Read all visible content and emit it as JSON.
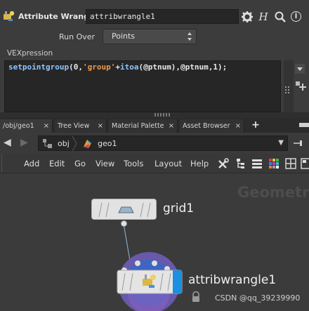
{
  "param_pane": {
    "node_type": "Attribute Wrangle",
    "node_name": "attribwrangle1",
    "run_over_label": "Run Over",
    "run_over_value": "Points",
    "vex_label": "VEXpression",
    "vex_code": {
      "fn": "setpointgroup",
      "p1": "(0,",
      "str": "'group'",
      "p2": "+",
      "fn2": "itoa",
      "p3": "(@ptnum),@ptnum,1);"
    },
    "help_glyph": "H",
    "info_glyph": "i"
  },
  "tabs": [
    {
      "label": "/obj/geo1",
      "close": "×"
    },
    {
      "label": "Tree View",
      "close": "×"
    },
    {
      "label": "Material Palette",
      "close": "×"
    },
    {
      "label": "Asset Browser",
      "close": "×"
    }
  ],
  "tab_add": "+",
  "path": {
    "back": "◀",
    "forward": "▶",
    "crumb1": "obj",
    "crumb2": "geo1",
    "dropdown": "▼"
  },
  "menu": [
    "Add",
    "Edit",
    "Go",
    "View",
    "Tools",
    "Layout",
    "Help"
  ],
  "network": {
    "context_label": "Geometry",
    "nodes": [
      {
        "name": "grid1"
      },
      {
        "name": "attribwrangle1"
      }
    ]
  },
  "watermark": "CSDN @qq_39239990",
  "colors": {
    "accent_blue": "#1b8fe0",
    "selection_ring": "#6a5bb0",
    "vex_function": "#8ec6ff",
    "vex_string": "#f09a4a"
  },
  "icons": {
    "gear": "gear-icon",
    "help": "help-icon",
    "search": "search-icon",
    "info": "info-icon"
  }
}
